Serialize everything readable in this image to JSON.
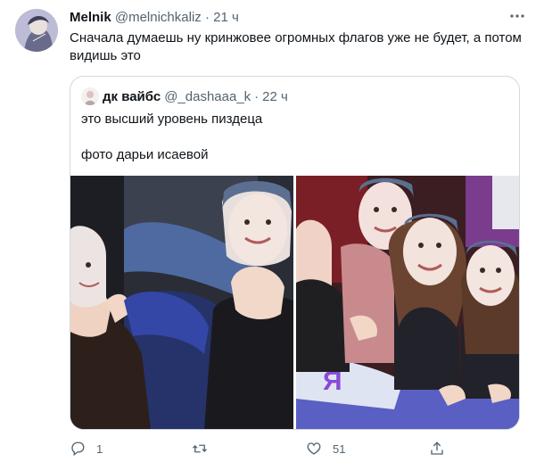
{
  "tweet": {
    "author_name": "Melnik",
    "author_handle": "@melnichkaliz",
    "separator": "·",
    "time": "21 ч",
    "text": "Сначала думаешь ну кринжовее огромных флагов уже не будет, а потом видишь это"
  },
  "quote": {
    "author_name": "дк вайбс",
    "author_handle": "@_dashaaa_k",
    "separator": "·",
    "time": "22 ч",
    "text_line1": "это высший уровень пиздеца",
    "text_line2": "фото дарьи исаевой"
  },
  "actions": {
    "reply_count": "1",
    "retweet_count": "",
    "like_count": "51"
  },
  "colors": {
    "text": "#0f1419",
    "muted": "#536471",
    "border": "#cfd9de"
  },
  "icons": [
    "more-icon",
    "reply-icon",
    "retweet-icon",
    "like-icon",
    "share-icon"
  ]
}
